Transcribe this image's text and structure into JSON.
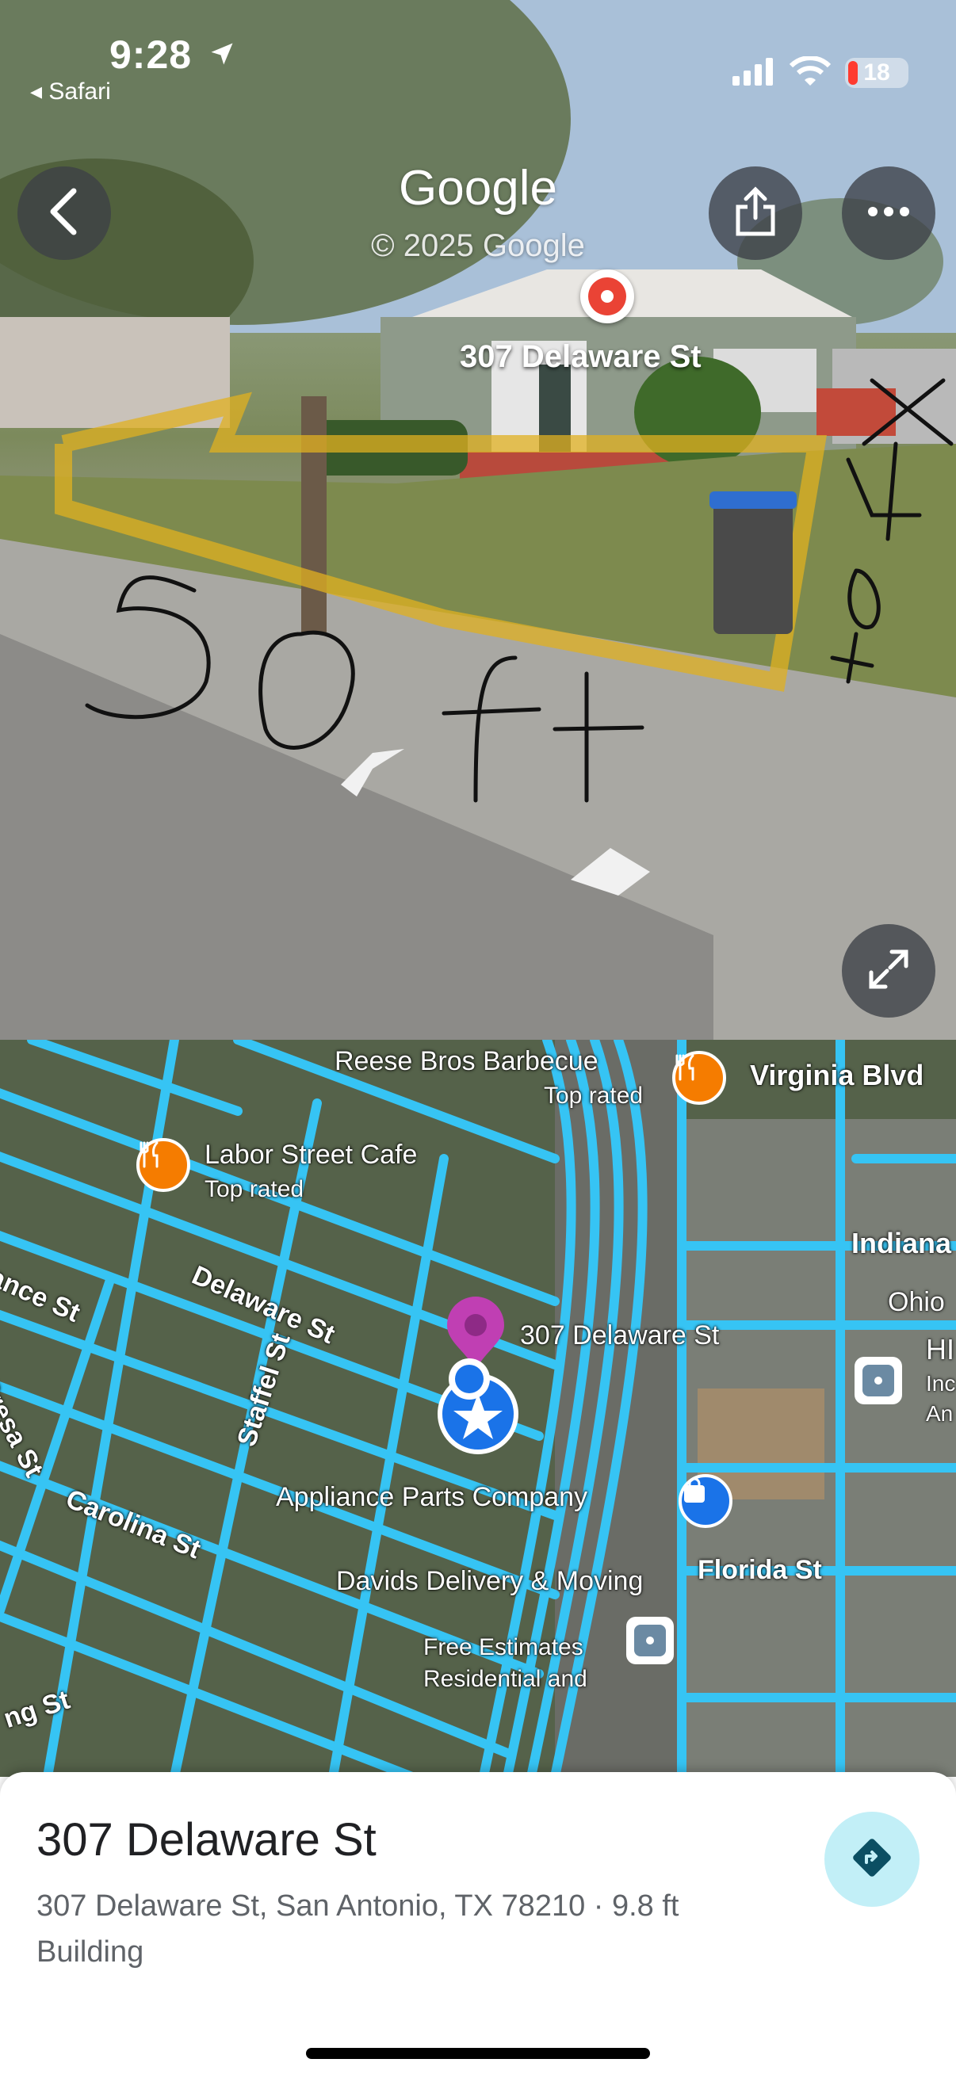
{
  "status_bar": {
    "time": "9:28",
    "back_app": "◂ Safari",
    "battery": "18",
    "location_icon": "location-arrow-icon",
    "signal_icon": "cellular-signal-icon",
    "wifi_icon": "wifi-icon"
  },
  "street_view": {
    "provider": "Google",
    "copyright": "© 2025 Google",
    "place_label": "307 Delaware St",
    "annotation_width": "50 ft",
    "annotation_depth": "x 40ft"
  },
  "map": {
    "places": [
      {
        "name": "Reese Bros Barbecue",
        "sub": "Top rated"
      },
      {
        "name": "Labor Street Cafe",
        "sub": "Top rated"
      },
      {
        "name": "307 Delaware St"
      },
      {
        "name": "Appliance Parts Company"
      },
      {
        "name": "Davids Delivery & Moving",
        "sub1": "Free Estimates",
        "sub2": "Residential and"
      }
    ],
    "streets": [
      "Virginia Blvd",
      "Indiana",
      "Ohio",
      "Delaware St",
      "Staffel St",
      "Carolina St",
      "Florida St",
      "ance St",
      "Presa St",
      "ng St"
    ],
    "partial_labels": [
      "HI",
      "Inc",
      "An"
    ]
  },
  "sheet": {
    "title": "307 Delaware St",
    "address": "307 Delaware St, San Antonio, TX 78210 · 9.8 ft",
    "type": "Building"
  },
  "colors": {
    "accent_blue": "#1a73e8",
    "street_cyan": "#36c4f4",
    "pin_red": "#ea4335",
    "food_orange": "#f57c00",
    "direction_bg": "#c2eff7"
  }
}
